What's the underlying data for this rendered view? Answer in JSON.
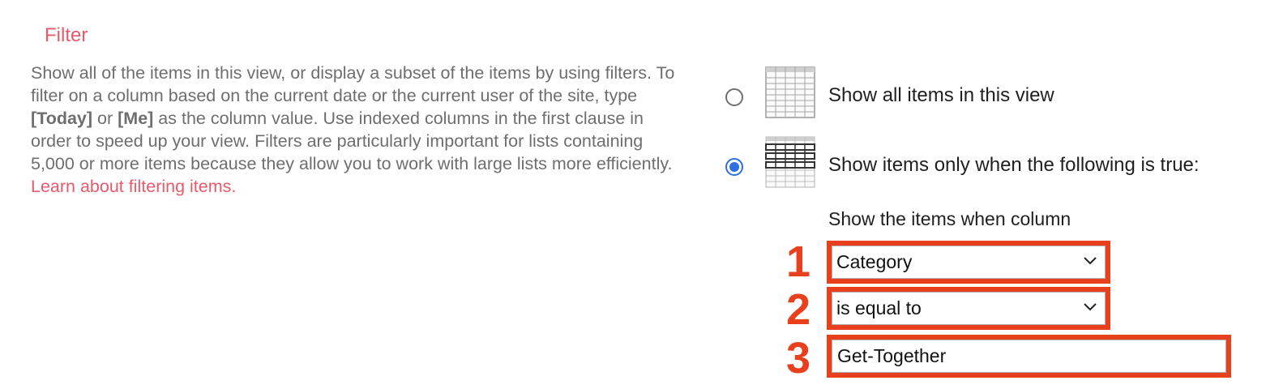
{
  "section": {
    "title": "Filter",
    "description": {
      "part1": "Show all of the items in this view, or display a subset of the items by using filters. To filter on a column based on the current date or the current user of the site, type ",
      "today_token": "[Today]",
      "part2": " or ",
      "me_token": "[Me]",
      "part3": " as the column value. Use indexed columns in the first clause in order to speed up your view. Filters are particularly important for lists containing 5,000 or more items because they allow you to work with large lists more efficiently. ",
      "link": "Learn about filtering items."
    }
  },
  "options": {
    "show_all": {
      "label": "Show all items in this view",
      "selected": false,
      "icon": "table-grid-icon"
    },
    "show_filtered": {
      "label": "Show items only when the following is true:",
      "selected": true,
      "icon": "table-filter-icon"
    }
  },
  "filter": {
    "heading": "Show the items when column",
    "column": {
      "value": "Category",
      "step": "1"
    },
    "operator": {
      "value": "is equal to",
      "step": "2"
    },
    "value_field": {
      "value": "Get-Together",
      "step": "3"
    }
  },
  "colors": {
    "accent": "#e8596b",
    "highlight": "#e8401c",
    "radio": "#2f6fe0"
  }
}
